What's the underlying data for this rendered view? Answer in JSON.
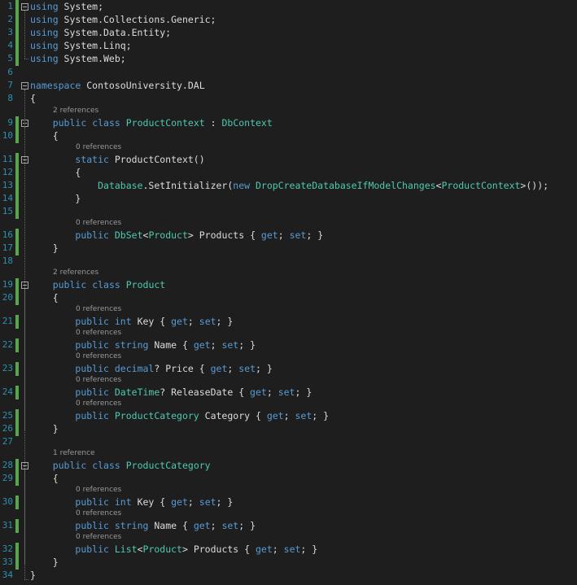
{
  "editor": {
    "lines": [
      {
        "num": "1",
        "tokens": [
          {
            "t": "using",
            "k": "kw"
          },
          {
            "t": " System;",
            "k": "pl"
          }
        ]
      },
      {
        "num": "2",
        "tokens": [
          {
            "t": "using",
            "k": "kw"
          },
          {
            "t": " System.Collections.Generic;",
            "k": "pl"
          }
        ]
      },
      {
        "num": "3",
        "tokens": [
          {
            "t": "using",
            "k": "kw"
          },
          {
            "t": " System.Data.Entity;",
            "k": "pl"
          }
        ]
      },
      {
        "num": "4",
        "tokens": [
          {
            "t": "using",
            "k": "kw"
          },
          {
            "t": " System.Linq;",
            "k": "pl"
          }
        ]
      },
      {
        "num": "5",
        "tokens": [
          {
            "t": "using",
            "k": "kw"
          },
          {
            "t": " System.Web;",
            "k": "pl"
          }
        ]
      },
      {
        "num": "6",
        "tokens": []
      },
      {
        "num": "7",
        "tokens": [
          {
            "t": "namespace",
            "k": "kw"
          },
          {
            "t": " ContosoUniversity.DAL",
            "k": "pl"
          }
        ]
      },
      {
        "num": "8",
        "tokens": [
          {
            "t": "{",
            "k": "pl"
          }
        ]
      },
      {
        "num": "9",
        "lens": "2 references",
        "tokens": [
          {
            "t": "    ",
            "k": "pl"
          },
          {
            "t": "public",
            "k": "kw"
          },
          {
            "t": " ",
            "k": "pl"
          },
          {
            "t": "class",
            "k": "kw"
          },
          {
            "t": " ",
            "k": "pl"
          },
          {
            "t": "ProductContext",
            "k": "ty"
          },
          {
            "t": " : ",
            "k": "pl"
          },
          {
            "t": "DbContext",
            "k": "ty"
          }
        ]
      },
      {
        "num": "10",
        "tokens": [
          {
            "t": "    {",
            "k": "pl"
          }
        ]
      },
      {
        "num": "11",
        "lens": "0 references",
        "tokens": [
          {
            "t": "        ",
            "k": "pl"
          },
          {
            "t": "static",
            "k": "kw"
          },
          {
            "t": " ProductContext()",
            "k": "pl"
          }
        ]
      },
      {
        "num": "12",
        "tokens": [
          {
            "t": "        {",
            "k": "pl"
          }
        ]
      },
      {
        "num": "13",
        "tokens": [
          {
            "t": "            ",
            "k": "pl"
          },
          {
            "t": "Database",
            "k": "ty"
          },
          {
            "t": ".SetInitializer(",
            "k": "pl"
          },
          {
            "t": "new",
            "k": "kw"
          },
          {
            "t": " ",
            "k": "pl"
          },
          {
            "t": "DropCreateDatabaseIfModelChanges",
            "k": "ty"
          },
          {
            "t": "<",
            "k": "pl"
          },
          {
            "t": "ProductContext",
            "k": "ty"
          },
          {
            "t": ">());",
            "k": "pl"
          }
        ]
      },
      {
        "num": "14",
        "tokens": [
          {
            "t": "        }",
            "k": "pl"
          }
        ]
      },
      {
        "num": "15",
        "tokens": []
      },
      {
        "num": "16",
        "lens": "0 references",
        "tokens": [
          {
            "t": "        ",
            "k": "pl"
          },
          {
            "t": "public",
            "k": "kw"
          },
          {
            "t": " ",
            "k": "pl"
          },
          {
            "t": "DbSet",
            "k": "ty"
          },
          {
            "t": "<",
            "k": "pl"
          },
          {
            "t": "Product",
            "k": "ty"
          },
          {
            "t": "> Products { ",
            "k": "pl"
          },
          {
            "t": "get",
            "k": "kw"
          },
          {
            "t": "; ",
            "k": "pl"
          },
          {
            "t": "set",
            "k": "kw"
          },
          {
            "t": "; }",
            "k": "pl"
          }
        ]
      },
      {
        "num": "17",
        "tokens": [
          {
            "t": "    }",
            "k": "pl"
          }
        ]
      },
      {
        "num": "18",
        "tokens": []
      },
      {
        "num": "19",
        "lens": "2 references",
        "tokens": [
          {
            "t": "    ",
            "k": "pl"
          },
          {
            "t": "public",
            "k": "kw"
          },
          {
            "t": " ",
            "k": "pl"
          },
          {
            "t": "class",
            "k": "kw"
          },
          {
            "t": " ",
            "k": "pl"
          },
          {
            "t": "Product",
            "k": "ty"
          }
        ]
      },
      {
        "num": "20",
        "tokens": [
          {
            "t": "    {",
            "k": "pl"
          }
        ]
      },
      {
        "num": "21",
        "lens": "0 references",
        "tokens": [
          {
            "t": "        ",
            "k": "pl"
          },
          {
            "t": "public",
            "k": "kw"
          },
          {
            "t": " ",
            "k": "pl"
          },
          {
            "t": "int",
            "k": "kw"
          },
          {
            "t": " Key { ",
            "k": "pl"
          },
          {
            "t": "get",
            "k": "kw"
          },
          {
            "t": "; ",
            "k": "pl"
          },
          {
            "t": "set",
            "k": "kw"
          },
          {
            "t": "; }",
            "k": "pl"
          }
        ]
      },
      {
        "num": "22",
        "lens": "0 references",
        "tokens": [
          {
            "t": "        ",
            "k": "pl"
          },
          {
            "t": "public",
            "k": "kw"
          },
          {
            "t": " ",
            "k": "pl"
          },
          {
            "t": "string",
            "k": "kw"
          },
          {
            "t": " Name { ",
            "k": "pl"
          },
          {
            "t": "get",
            "k": "kw"
          },
          {
            "t": "; ",
            "k": "pl"
          },
          {
            "t": "set",
            "k": "kw"
          },
          {
            "t": "; }",
            "k": "pl"
          }
        ]
      },
      {
        "num": "23",
        "lens": "0 references",
        "tokens": [
          {
            "t": "        ",
            "k": "pl"
          },
          {
            "t": "public",
            "k": "kw"
          },
          {
            "t": " ",
            "k": "pl"
          },
          {
            "t": "decimal",
            "k": "kw"
          },
          {
            "t": "? Price { ",
            "k": "pl"
          },
          {
            "t": "get",
            "k": "kw"
          },
          {
            "t": "; ",
            "k": "pl"
          },
          {
            "t": "set",
            "k": "kw"
          },
          {
            "t": "; }",
            "k": "pl"
          }
        ]
      },
      {
        "num": "24",
        "lens": "0 references",
        "tokens": [
          {
            "t": "        ",
            "k": "pl"
          },
          {
            "t": "public",
            "k": "kw"
          },
          {
            "t": " ",
            "k": "pl"
          },
          {
            "t": "DateTime",
            "k": "ty"
          },
          {
            "t": "? ReleaseDate { ",
            "k": "pl"
          },
          {
            "t": "get",
            "k": "kw"
          },
          {
            "t": "; ",
            "k": "pl"
          },
          {
            "t": "set",
            "k": "kw"
          },
          {
            "t": "; }",
            "k": "pl"
          }
        ]
      },
      {
        "num": "25",
        "lens": "0 references",
        "tokens": [
          {
            "t": "        ",
            "k": "pl"
          },
          {
            "t": "public",
            "k": "kw"
          },
          {
            "t": " ",
            "k": "pl"
          },
          {
            "t": "ProductCategory",
            "k": "ty"
          },
          {
            "t": " Category { ",
            "k": "pl"
          },
          {
            "t": "get",
            "k": "kw"
          },
          {
            "t": "; ",
            "k": "pl"
          },
          {
            "t": "set",
            "k": "kw"
          },
          {
            "t": "; }",
            "k": "pl"
          }
        ]
      },
      {
        "num": "26",
        "tokens": [
          {
            "t": "    }",
            "k": "pl"
          }
        ]
      },
      {
        "num": "27",
        "tokens": []
      },
      {
        "num": "28",
        "lens": "1 reference",
        "tokens": [
          {
            "t": "    ",
            "k": "pl"
          },
          {
            "t": "public",
            "k": "kw"
          },
          {
            "t": " ",
            "k": "pl"
          },
          {
            "t": "class",
            "k": "kw"
          },
          {
            "t": " ",
            "k": "pl"
          },
          {
            "t": "ProductCategory",
            "k": "ty"
          }
        ]
      },
      {
        "num": "29",
        "tokens": [
          {
            "t": "    {",
            "k": "pl"
          }
        ]
      },
      {
        "num": "30",
        "lens": "0 references",
        "tokens": [
          {
            "t": "        ",
            "k": "pl"
          },
          {
            "t": "public",
            "k": "kw"
          },
          {
            "t": " ",
            "k": "pl"
          },
          {
            "t": "int",
            "k": "kw"
          },
          {
            "t": " Key { ",
            "k": "pl"
          },
          {
            "t": "get",
            "k": "kw"
          },
          {
            "t": "; ",
            "k": "pl"
          },
          {
            "t": "set",
            "k": "kw"
          },
          {
            "t": "; }",
            "k": "pl"
          }
        ]
      },
      {
        "num": "31",
        "lens": "0 references",
        "tokens": [
          {
            "t": "        ",
            "k": "pl"
          },
          {
            "t": "public",
            "k": "kw"
          },
          {
            "t": " ",
            "k": "pl"
          },
          {
            "t": "string",
            "k": "kw"
          },
          {
            "t": " Name { ",
            "k": "pl"
          },
          {
            "t": "get",
            "k": "kw"
          },
          {
            "t": "; ",
            "k": "pl"
          },
          {
            "t": "set",
            "k": "kw"
          },
          {
            "t": "; }",
            "k": "pl"
          }
        ]
      },
      {
        "num": "32",
        "lens": "0 references",
        "tokens": [
          {
            "t": "        ",
            "k": "pl"
          },
          {
            "t": "public",
            "k": "kw"
          },
          {
            "t": " ",
            "k": "pl"
          },
          {
            "t": "List",
            "k": "ty"
          },
          {
            "t": "<",
            "k": "pl"
          },
          {
            "t": "Product",
            "k": "ty"
          },
          {
            "t": "> Products { ",
            "k": "pl"
          },
          {
            "t": "get",
            "k": "kw"
          },
          {
            "t": "; ",
            "k": "pl"
          },
          {
            "t": "set",
            "k": "kw"
          },
          {
            "t": "; }",
            "k": "pl"
          }
        ]
      },
      {
        "num": "33",
        "tokens": [
          {
            "t": "    }",
            "k": "pl"
          }
        ]
      },
      {
        "num": "34",
        "tokens": [
          {
            "t": "}",
            "k": "pl"
          }
        ]
      }
    ]
  },
  "colors": {
    "background": "#1e1e1e",
    "line_number": "#2b91af",
    "keyword": "#569cd6",
    "type": "#4ec9b0",
    "plain": "#dcdcdc",
    "codelens": "#999999",
    "change_bar": "#57a64a"
  }
}
